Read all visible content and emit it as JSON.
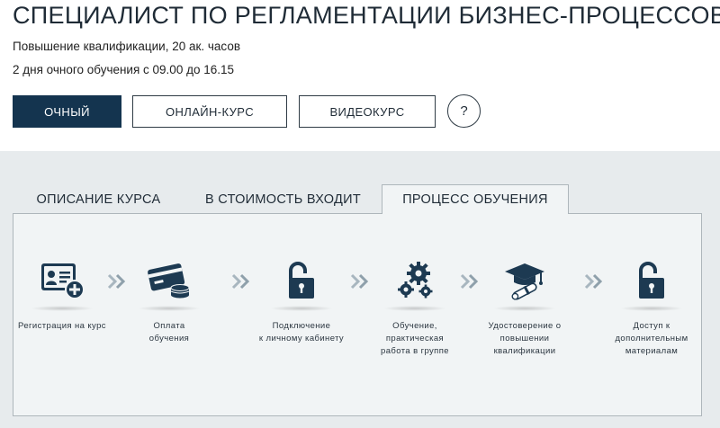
{
  "course": {
    "title": "СПЕЦИАЛИСТ ПО РЕГЛАМЕНТАЦИИ БИЗНЕС-ПРОЦЕССОВ",
    "qualification": "Повышение квалификации, 20 ак. часов",
    "schedule": "2 дня очного обучения с 09.00 до 16.15"
  },
  "formats": {
    "ochny": "ОЧНЫЙ",
    "online": "ОНЛАЙН-КУРС",
    "video": "ВИДЕОКУРС",
    "help": "?"
  },
  "tabs": {
    "description": "ОПИСАНИЕ КУРСА",
    "cost": "В СТОИМОСТЬ ВХОДИТ",
    "process": "ПРОЦЕСС ОБУЧЕНИЯ"
  },
  "steps": [
    {
      "line1": "Регистрация на курс",
      "line2": "",
      "line3": "",
      "icon": "user-card-plus-icon"
    },
    {
      "line1": "Оплата",
      "line2": "обучения",
      "line3": "",
      "icon": "credit-card-coins-icon"
    },
    {
      "line1": "Подключение",
      "line2": "к личному кабинету",
      "line3": "",
      "icon": "unlocked-padlock-icon"
    },
    {
      "line1": "Обучение,",
      "line2": "практическая",
      "line3": "работа в группе",
      "icon": "gears-icon"
    },
    {
      "line1": "Удостоверение о",
      "line2": "повышении",
      "line3": "квалификации",
      "icon": "graduation-cap-diploma-icon"
    },
    {
      "line1": "Доступ к",
      "line2": "дополнительным",
      "line3": "материалам",
      "icon": "unlocked-padlock-icon"
    }
  ],
  "colors": {
    "primary": "#14344f",
    "icon": "#1d3a52",
    "arrow": "#8fa0ab",
    "panel_bg": "#f1f4f5",
    "area_bg": "#e7ebed"
  }
}
